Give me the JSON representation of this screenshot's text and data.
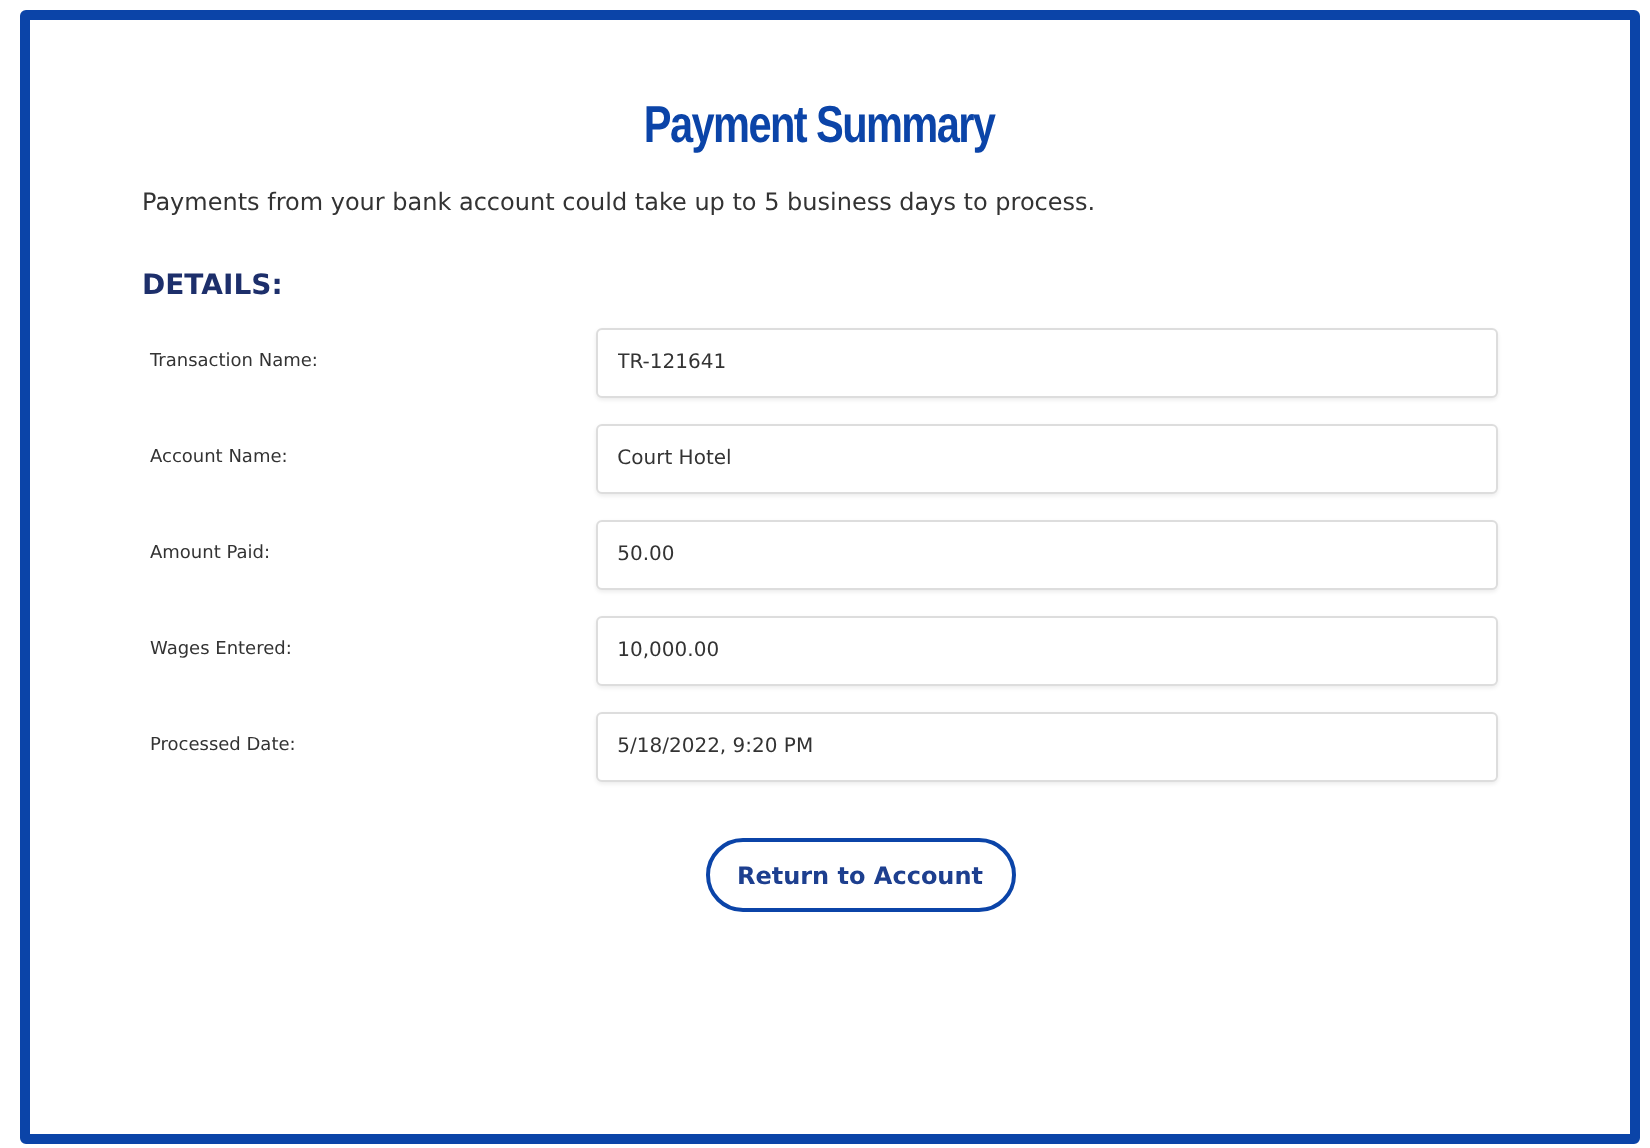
{
  "title": "Payment Summary",
  "notice": "Payments from your bank account could take up to 5 business days to process.",
  "section_heading": "DETAILS:",
  "fields": [
    {
      "label": "Transaction Name:",
      "value": "TR-121641"
    },
    {
      "label": "Account Name:",
      "value": "Court Hotel"
    },
    {
      "label": "Amount Paid:",
      "value": "50.00"
    },
    {
      "label": "Wages Entered:",
      "value": "10,000.00"
    },
    {
      "label": "Processed Date:",
      "value": "5/18/2022, 9:20 PM"
    }
  ],
  "button": "Return to Account"
}
